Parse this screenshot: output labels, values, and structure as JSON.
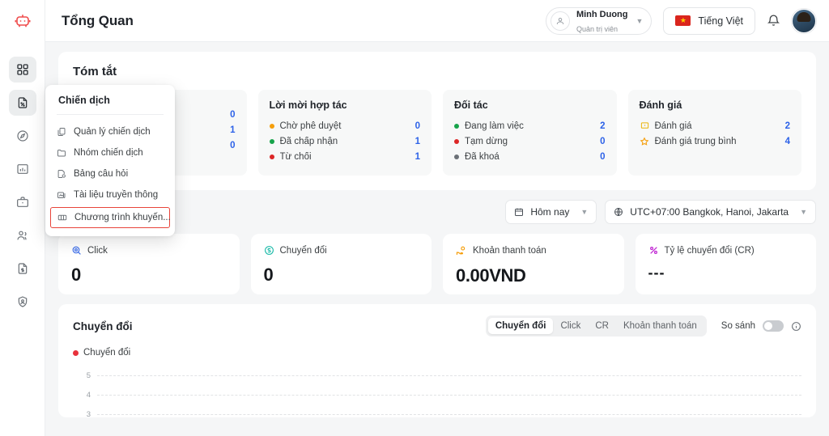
{
  "brand": {
    "logo_icon": "robot-logo-icon",
    "logo_color": "#ef4b4b"
  },
  "sidebar": {
    "items": [
      {
        "name": "dashboard",
        "icon": "grid-icon",
        "active": true
      },
      {
        "name": "campaign",
        "icon": "file-percent-icon",
        "active": true
      },
      {
        "name": "discover",
        "icon": "compass-icon",
        "active": false
      },
      {
        "name": "reports",
        "icon": "bar-chart-icon",
        "active": false
      },
      {
        "name": "finance",
        "icon": "briefcase-icon",
        "active": false
      },
      {
        "name": "partners",
        "icon": "users-icon",
        "active": false
      },
      {
        "name": "invoices",
        "icon": "document-dollar-icon",
        "active": false
      },
      {
        "name": "security",
        "icon": "shield-user-icon",
        "active": false
      }
    ]
  },
  "header": {
    "title": "Tổng Quan",
    "account": {
      "name": "Minh Duong",
      "role": "Quản trị viên",
      "avatar_icon": "user-icon",
      "caret_icon": "chevron-down-icon"
    },
    "language": {
      "label": "Tiếng Việt",
      "flag_icon": "vietnam-flag-icon",
      "star": "★"
    },
    "notification_icon": "bell-icon",
    "profile_avatar": "user-photo-avatar"
  },
  "dropdown": {
    "title": "Chiến dịch",
    "items": [
      {
        "label": "Quản lý chiến dịch",
        "icon": "copy-icon",
        "highlighted": false
      },
      {
        "label": "Nhóm chiến dịch",
        "icon": "folder-icon",
        "highlighted": false
      },
      {
        "label": "Bảng câu hỏi",
        "icon": "file-question-icon",
        "highlighted": false
      },
      {
        "label": "Tài liệu truyền thông",
        "icon": "media-library-icon",
        "highlighted": false
      },
      {
        "label": "Chương trình khuyến...",
        "icon": "ticket-icon",
        "highlighted": true
      }
    ],
    "highlight_color": "#e8443a"
  },
  "summary": {
    "title": "Tóm tắt",
    "cards": [
      {
        "title": "",
        "rows": [
          {
            "label": "",
            "value": "0",
            "dot": "#f59e0b"
          },
          {
            "label": "",
            "value": "1",
            "dot": "#16a34a"
          },
          {
            "label": "",
            "value": "0",
            "dot": "#dc2626"
          }
        ]
      },
      {
        "title": "Lời mời hợp tác",
        "rows": [
          {
            "label": "Chờ phê duyệt",
            "value": "0",
            "dot": "#f59e0b"
          },
          {
            "label": "Đã chấp nhận",
            "value": "1",
            "dot": "#16a34a"
          },
          {
            "label": "Từ chối",
            "value": "1",
            "dot": "#dc2626"
          }
        ]
      },
      {
        "title": "Đối tác",
        "rows": [
          {
            "label": "Đang làm việc",
            "value": "2",
            "dot": "#16a34a"
          },
          {
            "label": "Tạm dừng",
            "value": "0",
            "dot": "#dc2626"
          },
          {
            "label": "Đã khoá",
            "value": "0",
            "dot": "#6b7177"
          }
        ]
      },
      {
        "title": "Đánh giá",
        "rows": [
          {
            "label": "Đánh giá",
            "value": "2",
            "icon": "review-box-icon",
            "icon_color": "#eab308"
          },
          {
            "label": "Đánh giá trung bình",
            "value": "4",
            "icon": "star-icon",
            "icon_color": "#f59e0b"
          }
        ]
      }
    ]
  },
  "filters": {
    "date_range": {
      "label": "Hôm nay",
      "icon": "calendar-icon",
      "caret": "chevron-down-icon"
    },
    "timezone": {
      "label": "UTC+07:00 Bangkok, Hanoi, Jakarta",
      "icon": "globe-icon",
      "caret": "chevron-down-icon"
    }
  },
  "kpis": [
    {
      "label": "Click",
      "value": "0",
      "icon": "click-target-icon",
      "icon_color": "#2d62e8"
    },
    {
      "label": "Chuyển đổi",
      "value": "0",
      "icon": "conversion-refresh-icon",
      "icon_color": "#14b8a6"
    },
    {
      "label": "Khoản thanh toán",
      "value": "0.00VND",
      "icon": "payment-hand-icon",
      "icon_color": "#f59e0b"
    },
    {
      "label": "Tỷ lệ chuyển đổi (CR)",
      "value": "---",
      "icon": "percent-icon",
      "icon_color": "#c026d3"
    }
  ],
  "chart_panel": {
    "title": "Chuyển đổi",
    "tabs": [
      {
        "label": "Chuyển đổi",
        "active": true
      },
      {
        "label": "Click",
        "active": false
      },
      {
        "label": "CR",
        "active": false
      },
      {
        "label": "Khoản thanh toán",
        "active": false
      }
    ],
    "compare": {
      "label": "So sánh",
      "enabled": false,
      "info_icon": "info-circle-icon"
    }
  },
  "chart_data": {
    "type": "line",
    "title": "Chuyển đổi",
    "series": [
      {
        "name": "Chuyển đổi",
        "color": "#e8323c",
        "values": []
      }
    ],
    "legend": [
      {
        "label": "Chuyển đổi",
        "color": "#e8323c"
      }
    ],
    "yticks": [
      "5",
      "4",
      "3"
    ],
    "ylim": [
      0,
      5
    ],
    "x": [],
    "xlabel": "",
    "ylabel": "",
    "grid": true,
    "legend_position": "top-left"
  }
}
